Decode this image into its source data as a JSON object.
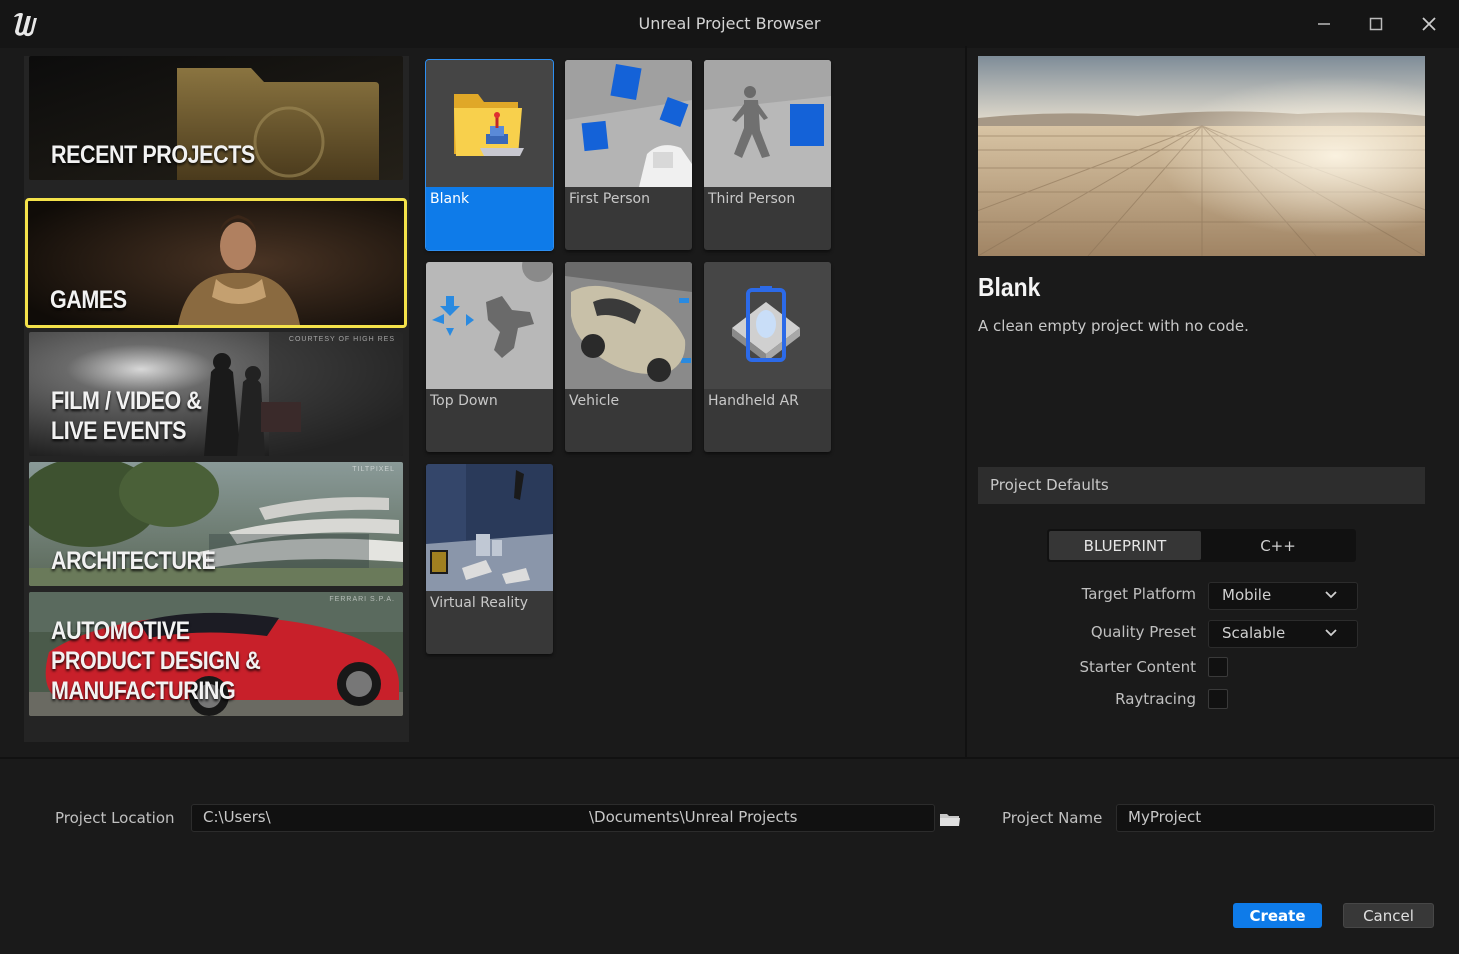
{
  "window": {
    "title": "Unreal Project Browser"
  },
  "categories": [
    {
      "label": "RECENT PROJECTS",
      "credit": "",
      "selected": false
    },
    {
      "label": "GAMES",
      "credit": "",
      "selected": true
    },
    {
      "label": "FILM / VIDEO &\nLIVE EVENTS",
      "credit": "COURTESY OF HIGH RES",
      "selected": false
    },
    {
      "label": "ARCHITECTURE",
      "credit": "TILTPIXEL",
      "selected": false
    },
    {
      "label": "AUTOMOTIVE\nPRODUCT DESIGN &\nMANUFACTURING",
      "credit": "FERRARI S.P.A.",
      "selected": false
    }
  ],
  "templates": [
    {
      "label": "Blank",
      "selected": true
    },
    {
      "label": "First Person",
      "selected": false
    },
    {
      "label": "Third Person",
      "selected": false
    },
    {
      "label": "Top Down",
      "selected": false
    },
    {
      "label": "Vehicle",
      "selected": false
    },
    {
      "label": "Handheld AR",
      "selected": false
    },
    {
      "label": "Virtual Reality",
      "selected": false
    }
  ],
  "details": {
    "title": "Blank",
    "description": "A clean empty project with no code."
  },
  "defaults": {
    "header": "Project Defaults",
    "language_options": [
      "BLUEPRINT",
      "C++"
    ],
    "language_selected": "BLUEPRINT",
    "target_platform_label": "Target Platform",
    "target_platform_value": "Mobile",
    "quality_preset_label": "Quality Preset",
    "quality_preset_value": "Scalable",
    "starter_content_label": "Starter Content",
    "starter_content_checked": false,
    "raytracing_label": "Raytracing",
    "raytracing_checked": false
  },
  "bottom": {
    "location_label": "Project Location",
    "location_value_left": "C:\\Users\\",
    "location_value_right": "\\Documents\\Unreal Projects",
    "name_label": "Project Name",
    "name_value": "MyProject",
    "create_label": "Create",
    "cancel_label": "Cancel"
  },
  "colors": {
    "accent": "#0e7be9",
    "selected_border": "#f4e24a",
    "background": "#1a1a1a"
  }
}
